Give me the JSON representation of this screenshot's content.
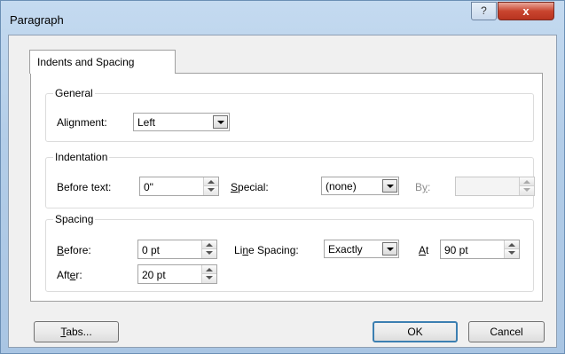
{
  "window": {
    "title": "Paragraph",
    "help_label": "?",
    "close_label": "x"
  },
  "tab": {
    "label": "Indents and Spacing"
  },
  "general": {
    "title": "General",
    "alignment_label_pre": "Ali",
    "alignment_label_key": "g",
    "alignment_label_post": "nment:",
    "alignment_value": "Left"
  },
  "indentation": {
    "title": "Indentation",
    "before_text_label": "Before text:",
    "before_text_value": "0\"",
    "special_label_key": "S",
    "special_label_post": "pecial:",
    "special_value": "(none)",
    "by_label_pre": "B",
    "by_label_key": "y",
    "by_label_post": ":",
    "by_value": ""
  },
  "spacing": {
    "title": "Spacing",
    "before_label_key": "B",
    "before_label_post": "efore:",
    "before_value": "0 pt",
    "after_label_pre": "Aft",
    "after_label_key": "e",
    "after_label_post": "r:",
    "after_value": "20 pt",
    "line_spacing_label_pre": "Li",
    "line_spacing_label_key": "n",
    "line_spacing_label_post": "e Spacing:",
    "line_spacing_value": "Exactly",
    "at_label_key": "A",
    "at_label_post": "t",
    "at_value": "90 pt"
  },
  "buttons": {
    "tabs_key": "T",
    "tabs_post": "abs...",
    "ok": "OK",
    "cancel": "Cancel"
  }
}
